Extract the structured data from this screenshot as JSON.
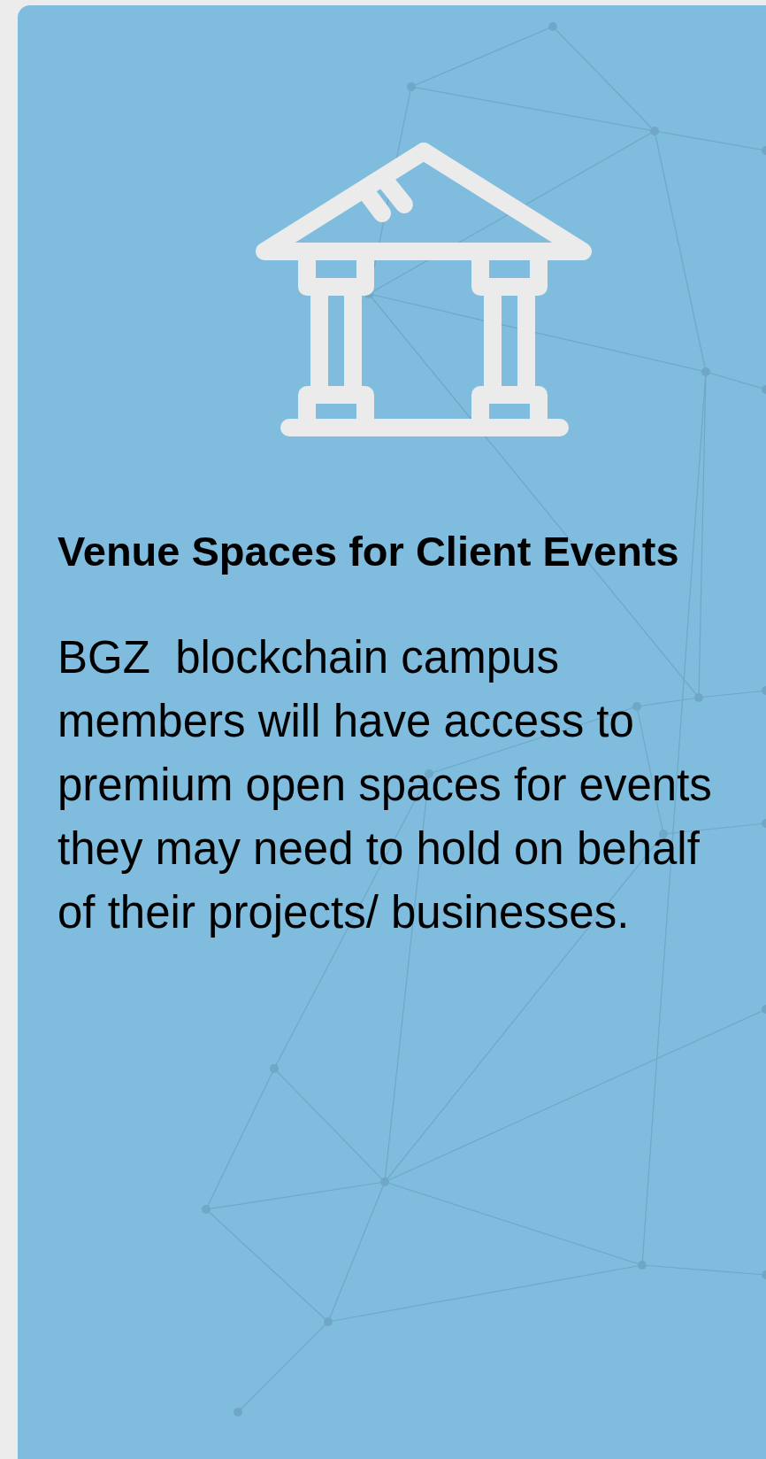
{
  "card": {
    "title": "Venue Spaces for Client Events",
    "description": "BGZ  blockchain campus members will have access to premium open spaces for events they may need to hold on behalf of their projects/ businesses."
  }
}
